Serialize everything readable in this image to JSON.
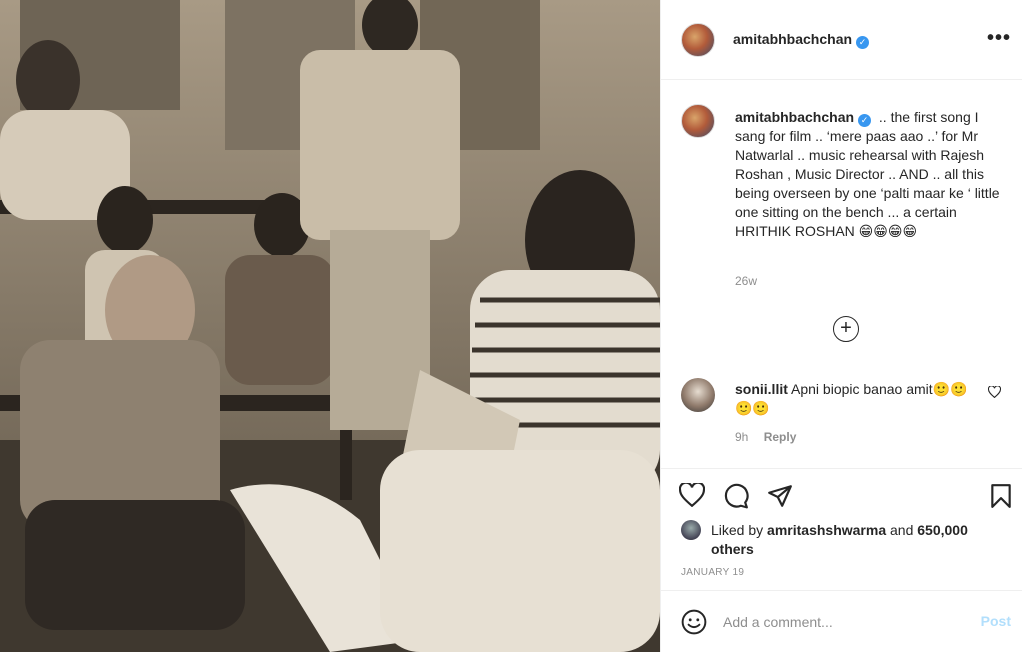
{
  "post": {
    "photo": {
      "alt_subject": "vintage-black-and-white-photo"
    },
    "header": {
      "username": "amitabhbachchan",
      "verified": true,
      "more_label": "•••"
    },
    "caption": {
      "username": "amitabhbachchan",
      "text": ".. the first song I sang for film .. ‘mere paas aao ..’ for Mr Natwarlal .. music rehearsal with Rajesh Roshan , Music Director .. AND .. all this being overseen by one ‘palti maar ke ‘ little one sitting on the bench ... a certain HRITHIK ROSHAN 😁😁😁😁",
      "time": "26w",
      "load_more_label": "+"
    },
    "comments": [
      {
        "username": "sonii.llit",
        "text": "Apni biopic banao amit🙂🙂🙂🙂",
        "time": "9h",
        "reply_label": "Reply"
      }
    ],
    "actions": {
      "like_icon": "heart-icon",
      "comment_icon": "comment-icon",
      "share_icon": "share-icon",
      "save_icon": "bookmark-icon"
    },
    "likes": {
      "prefix": "Liked by",
      "user": "amritashshwarma",
      "joiner": "and",
      "others": "650,000 others"
    },
    "date": "JANUARY 19",
    "add_comment": {
      "placeholder": "Add a comment...",
      "post_label": "Post"
    },
    "colors": {
      "verified_blue": "#3897f0",
      "post_disabled": "#b2dffc",
      "muted_text": "#8e8e8e",
      "border": "#efefef"
    }
  }
}
